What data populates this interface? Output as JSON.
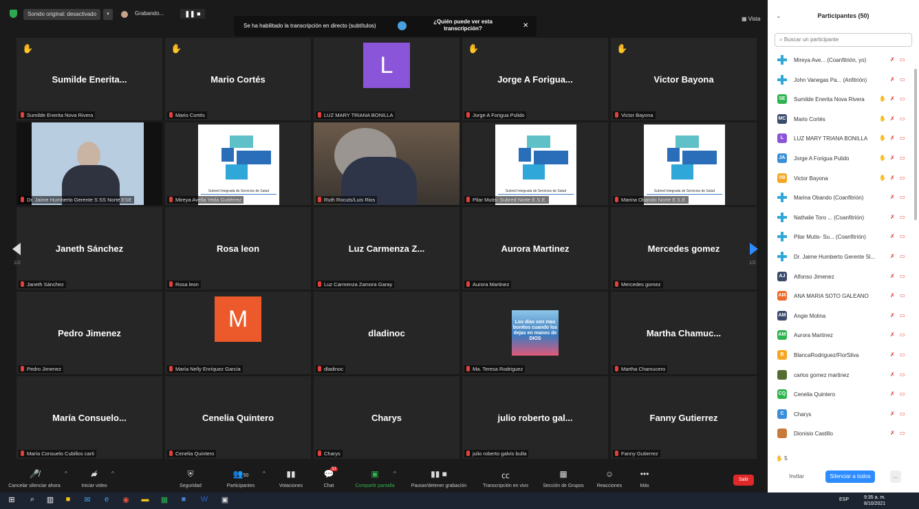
{
  "topbar": {
    "audio": "Sonido original: desactivado",
    "recording": "Grabando...",
    "view": "Vista",
    "caption_msg": "Se ha habilitado la transcripción en directo (subtítulos)",
    "caption_who": "¿Quién puede ver esta transcripción?"
  },
  "grid": {
    "page": "1/2",
    "page_right": "1/2",
    "tiles": [
      {
        "name": "Sumilde  Enerita...",
        "label": "Sumilde Enerita Nova Rivera"
      },
      {
        "name": "Mario Cortés",
        "label": "Mario Cortés"
      },
      {
        "name": "",
        "label": "LUZ MARY TRIANA BONILLA",
        "letter": "L"
      },
      {
        "name": "Jorge A Forigua...",
        "label": "Jorge A Forigua Pulido"
      },
      {
        "name": "Victor Bayona",
        "label": "Victor Bayona"
      },
      {
        "name": "",
        "label": "Dr. Jaime Humberto Gerente S SS Norte ESE"
      },
      {
        "name": "",
        "label": "Mireya Avella Yeda Gutiérrez"
      },
      {
        "name": "",
        "label": "Ruth Rocuts/Luis Rios"
      },
      {
        "name": "",
        "label": "Pilar Mutis- Subred Norte E.S.E."
      },
      {
        "name": "",
        "label": "Marina Obando Norte E.S.E."
      },
      {
        "name": "Janeth Sánchez",
        "label": "Janeth Sánchez"
      },
      {
        "name": "Rosa leon",
        "label": "Rosa leon"
      },
      {
        "name": "Luz Carmenza Z...",
        "label": "Luz Carmenza Zamora Garay"
      },
      {
        "name": "Aurora Martinez",
        "label": "Aurora Martinez"
      },
      {
        "name": "Mercedes gomez",
        "label": "Mercedes gomez"
      },
      {
        "name": "Pedro Jimenez",
        "label": "Pedro Jimenez"
      },
      {
        "name": "",
        "label": "María Nelly Enríquez García",
        "letter": "M"
      },
      {
        "name": "dladinoc",
        "label": "dladinoc"
      },
      {
        "name": "",
        "label": "Ma. Teresa Rodriguez",
        "image_text": "Los dias son mas bonitos cuando los dejas en manos de DIOS"
      },
      {
        "name": "Martha Chamuc...",
        "label": "Martha Chamucero"
      },
      {
        "name": "María  Consuelo...",
        "label": "María Consuelo Cubillos carti"
      },
      {
        "name": "Cenelia Quintero",
        "label": "Cenelia Quintero"
      },
      {
        "name": "Charys",
        "label": "Charys"
      },
      {
        "name": "julio roberto gal...",
        "label": "julio roberto galvis bulla"
      },
      {
        "name": "Fanny Gutierrez",
        "label": "Fanny Gutierrez"
      }
    ],
    "logo_caption": "Subred Integrada de Servicios de Salud"
  },
  "sidebar": {
    "title": "Participantes (50)",
    "search_placeholder": "Buscar un participante",
    "participants": [
      {
        "initials": "",
        "name": "Mireya Ave... (Coanfitrión, yo)",
        "color": "cross"
      },
      {
        "initials": "",
        "name": "John Vanegas Pa... (Anfitrión)",
        "color": "cross"
      },
      {
        "initials": "SE",
        "name": "Sumilde Enerita Nova Rivera",
        "color": "#2fb34f"
      },
      {
        "initials": "MC",
        "name": "Mario Cortés",
        "color": "#3a4a6b"
      },
      {
        "initials": "L",
        "name": "LUZ MARY TRIANA BONILLA",
        "color": "#8a55d8"
      },
      {
        "initials": "JA",
        "name": "Jorge A Forigua Pulido",
        "color": "#3a8fd8"
      },
      {
        "initials": "VB",
        "name": "Victor Bayona",
        "color": "#f5a623"
      },
      {
        "initials": "",
        "name": "Marina Obando (Coanfitrión)",
        "color": "cross"
      },
      {
        "initials": "",
        "name": "Nathalie Toro ... (Coanfitrión)",
        "color": "cross"
      },
      {
        "initials": "",
        "name": "Pilar Mutis- Su... (Coanfitrión)",
        "color": "cross"
      },
      {
        "initials": "",
        "name": "Dr. Jaime Humberto Gerente Sl...",
        "color": "cross"
      },
      {
        "initials": "AJ",
        "name": "Alfonso Jimenez",
        "color": "#3a4a6b"
      },
      {
        "initials": "AM",
        "name": "ANA MARIA SOTO GALEANO",
        "color": "#ec6a2b"
      },
      {
        "initials": "AM",
        "name": "Angie Molina",
        "color": "#3a4a6b"
      },
      {
        "initials": "AM",
        "name": "Aurora Martinez",
        "color": "#2fb34f"
      },
      {
        "initials": "B",
        "name": "BlancaRodriguez/FlorSilva",
        "color": "#f5a623"
      },
      {
        "initials": "",
        "name": "carlos gomez martinez",
        "color": "#556b2f"
      },
      {
        "initials": "CQ",
        "name": "Cenelia Quintero",
        "color": "#2fb34f"
      },
      {
        "initials": "C",
        "name": "Charys",
        "color": "#3a8fd8"
      },
      {
        "initials": "",
        "name": "Dionisio Castillo",
        "color": "#c87a3a"
      }
    ],
    "raised_count": "5",
    "invite": "Invitar",
    "mute_all": "Silenciar a todos",
    "more": "..."
  },
  "toolbar": {
    "mute": "Cancelar silenciar ahora",
    "video": "Iniciar video",
    "security": "Seguridad",
    "participants": "Participantes",
    "participants_count": "50",
    "polls": "Votaciones",
    "chat": "Chat",
    "chat_badge": "33",
    "share": "Compartir pantalla",
    "record": "Pausar/detener grabación",
    "transcription": "Transcripción en vivo",
    "breakout": "Sección de Grupos",
    "reactions": "Reacciones",
    "more": "Más",
    "leave": "Salir"
  },
  "taskbar": {
    "lang": "ESP",
    "time": "9:35 a. m.",
    "date": "8/10/2021"
  }
}
